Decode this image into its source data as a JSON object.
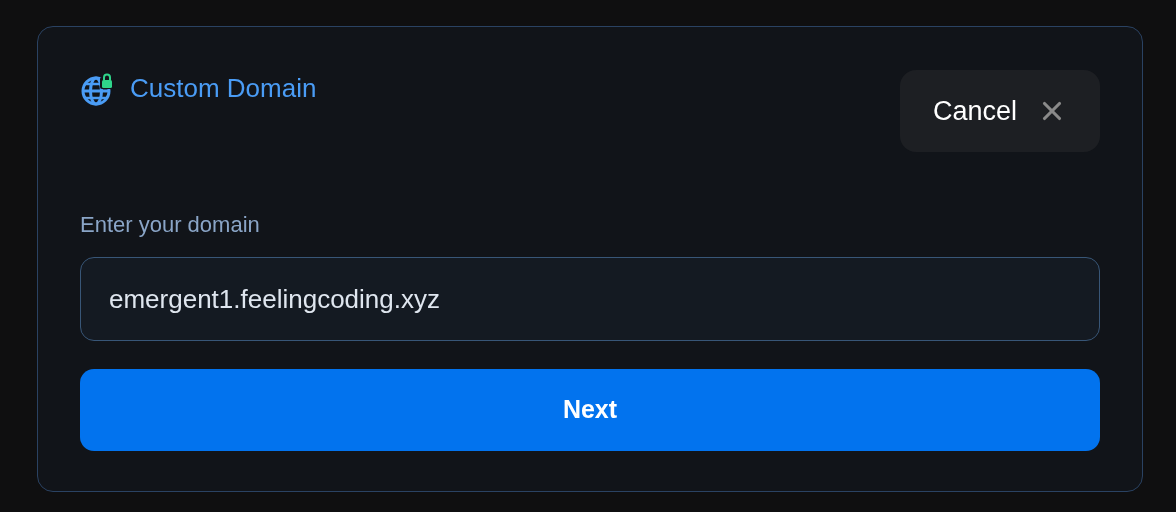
{
  "dialog": {
    "title": "Custom Domain",
    "cancel": "Cancel"
  },
  "field": {
    "label": "Enter your domain",
    "value": "emergent1.feelingcoding.xyz"
  },
  "submit": "Next"
}
